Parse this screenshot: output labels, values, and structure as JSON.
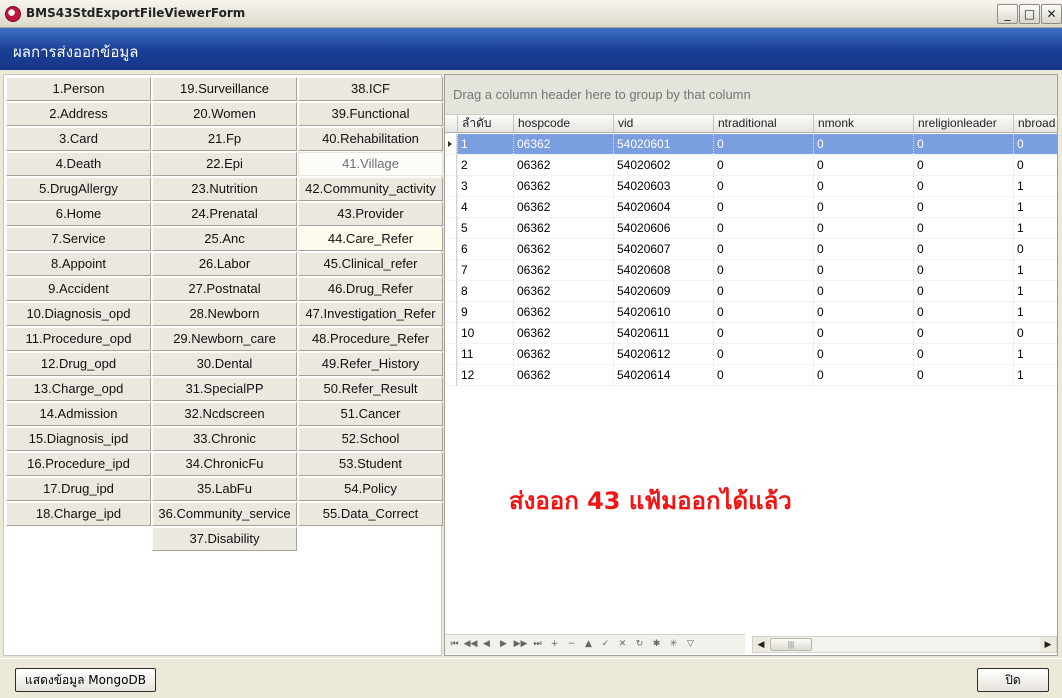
{
  "window": {
    "title": "BMS43StdExportFileViewerForm"
  },
  "header": {
    "title": "ผลการส่งออกข้อมูล"
  },
  "file_buttons": {
    "col1": [
      "1.Person",
      "2.Address",
      "3.Card",
      "4.Death",
      "5.DrugAllergy",
      "6.Home",
      "7.Service",
      "8.Appoint",
      "9.Accident",
      "10.Diagnosis_opd",
      "11.Procedure_opd",
      "12.Drug_opd",
      "13.Charge_opd",
      "14.Admission",
      "15.Diagnosis_ipd",
      "16.Procedure_ipd",
      "17.Drug_ipd",
      "18.Charge_ipd"
    ],
    "col2": [
      "19.Surveillance",
      "20.Women",
      "21.Fp",
      "22.Epi",
      "23.Nutrition",
      "24.Prenatal",
      "25.Anc",
      "26.Labor",
      "27.Postnatal",
      "28.Newborn",
      "29.Newborn_care",
      "30.Dental",
      "31.SpecialPP",
      "32.Ncdscreen",
      "33.Chronic",
      "34.ChronicFu",
      "35.LabFu",
      "36.Community_service",
      "37.Disability"
    ],
    "col3": [
      "38.ICF",
      "39.Functional",
      "40.Rehabilitation",
      "41.Village",
      "42.Community_activity",
      "43.Provider",
      "44.Care_Refer",
      "45.Clinical_refer",
      "46.Drug_Refer",
      "47.Investigation_Refer",
      "48.Procedure_Refer",
      "49.Refer_History",
      "50.Refer_Result",
      "51.Cancer",
      "52.School",
      "53.Student",
      "54.Policy",
      "55.Data_Correct"
    ],
    "active": "41.Village"
  },
  "grid": {
    "group_hint": "Drag a column header here to group by that column",
    "columns": [
      "ลำดับ",
      "hospcode",
      "vid",
      "ntraditional",
      "nmonk",
      "nreligionleader",
      "nbroad"
    ],
    "rows": [
      [
        "1",
        "06362",
        "54020601",
        "0",
        "0",
        "0",
        "0"
      ],
      [
        "2",
        "06362",
        "54020602",
        "0",
        "0",
        "0",
        "0"
      ],
      [
        "3",
        "06362",
        "54020603",
        "0",
        "0",
        "0",
        "1"
      ],
      [
        "4",
        "06362",
        "54020604",
        "0",
        "0",
        "0",
        "1"
      ],
      [
        "5",
        "06362",
        "54020606",
        "0",
        "0",
        "0",
        "1"
      ],
      [
        "6",
        "06362",
        "54020607",
        "0",
        "0",
        "0",
        "0"
      ],
      [
        "7",
        "06362",
        "54020608",
        "0",
        "0",
        "0",
        "1"
      ],
      [
        "8",
        "06362",
        "54020609",
        "0",
        "0",
        "0",
        "1"
      ],
      [
        "9",
        "06362",
        "54020610",
        "0",
        "0",
        "0",
        "1"
      ],
      [
        "10",
        "06362",
        "54020611",
        "0",
        "0",
        "0",
        "0"
      ],
      [
        "11",
        "06362",
        "54020612",
        "0",
        "0",
        "0",
        "1"
      ],
      [
        "12",
        "06362",
        "54020614",
        "0",
        "0",
        "0",
        "1"
      ]
    ],
    "selected_row": 0,
    "status_message": "ส่งออก 43 แฟ้มออกได้แล้ว"
  },
  "footer": {
    "mongo_button": "แสดงข้อมูล MongoDB",
    "close_button": "ปิด"
  },
  "colors": {
    "header_bg": "#1a3f94",
    "selected_row": "#7b9ee0",
    "status_text": "#f01414"
  }
}
